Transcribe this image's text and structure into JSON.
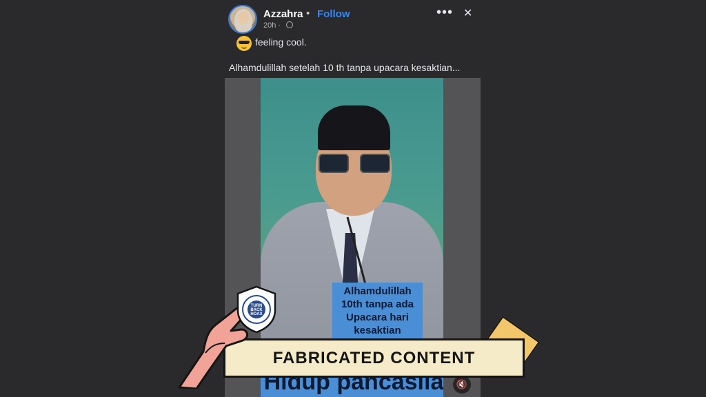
{
  "post": {
    "author": "Azzahra",
    "separator": "•",
    "follow_label": "Follow",
    "time": "20h ·",
    "feeling": "feeling cool.",
    "caption": "Alhamdulillah setelah 10 th tanpa upacara kesaktian..."
  },
  "video": {
    "overlay_lines": [
      "Alhamdulillah",
      "10th tanpa ada",
      "Upacara hari",
      "kesaktian"
    ],
    "bottom_text": "Hidup pancasila"
  },
  "badge": {
    "label": "FABRICATED CONTENT",
    "logo_text": "TURN BACK HOAX",
    "logo_ring": "MASYARAKAT ANTI FITNAH INDONESIA • MAFINDO •",
    "colors": {
      "banner": "#f6ebc8",
      "tape": "#f2c66a",
      "hand": "#f0a396"
    }
  },
  "icons": {
    "more": "more-options-icon",
    "close": "close-icon",
    "globe": "globe-icon",
    "feeling": "cool-emoji-icon",
    "mute": "mute-icon"
  }
}
